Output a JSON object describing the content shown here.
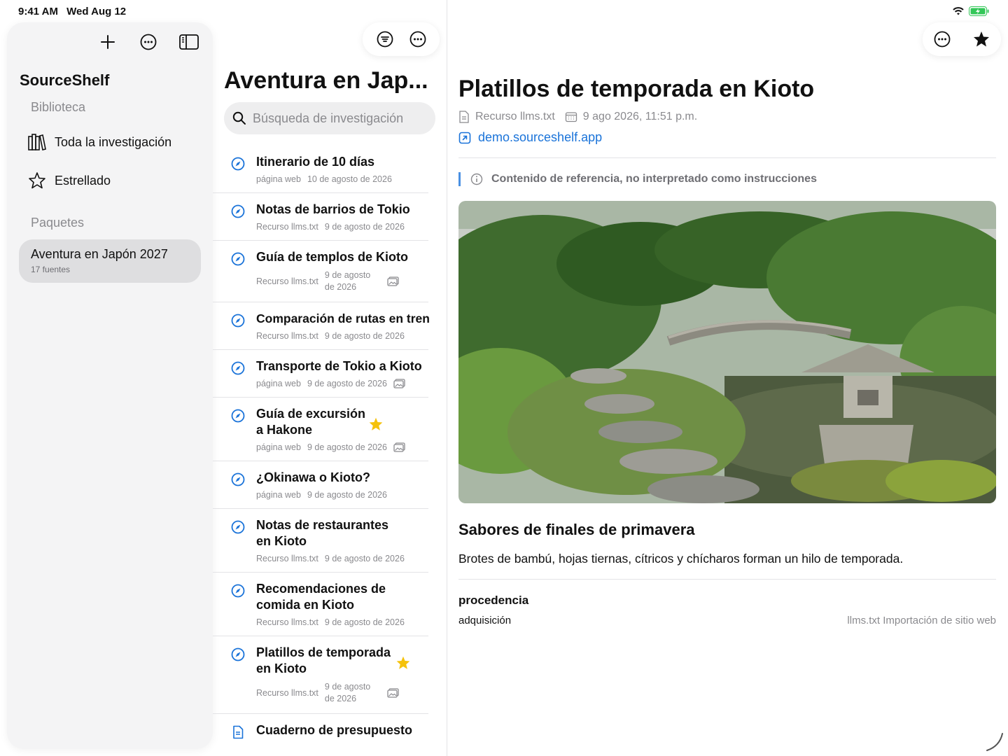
{
  "status_bar": {
    "time": "9:41 AM",
    "date": "Wed Aug 12"
  },
  "sidebar": {
    "app_title": "SourceShelf",
    "library_heading": "Biblioteca",
    "items": [
      {
        "label": "Toda la investigación",
        "icon": "books-icon"
      },
      {
        "label": "Estrellado",
        "icon": "star-outline-icon"
      }
    ],
    "packs_heading": "Paquetes",
    "pack": {
      "name": "Aventura en Japón 2027",
      "count": "17 fuentes"
    }
  },
  "list": {
    "title": "Aventura en Jap...",
    "search_placeholder": "Búsqueda de investigación",
    "rows": [
      {
        "title": "Itinerario de 10 días",
        "source": "página web",
        "date": "10 de agosto de 2026"
      },
      {
        "title": "Notas de barrios de Tokio",
        "source": "Recurso llms.txt",
        "date": "9 de agosto de 2026"
      },
      {
        "title": "Guía de templos de Kioto",
        "source": "Recurso llms.txt",
        "date": "9 de agosto de 2026"
      },
      {
        "title": "Comparación de rutas en tren",
        "source": "Recurso llms.txt",
        "date": "9 de agosto de 2026"
      },
      {
        "title": "Transporte de Tokio a Kioto",
        "source": "página web",
        "date": "9 de agosto de 2026"
      },
      {
        "title": "Guía de excursión a Hakone",
        "source": "página web",
        "date": "9 de agosto de 2026"
      },
      {
        "title": "¿Okinawa o Kioto?",
        "source": "página web",
        "date": "9 de agosto de 2026"
      },
      {
        "title": "Notas de restaurantes en Kioto",
        "source": "Recurso llms.txt",
        "date": "9 de agosto de 2026"
      },
      {
        "title": "Recomendaciones de comida en Kioto",
        "source": "Recurso llms.txt",
        "date": "9 de agosto de 2026"
      },
      {
        "title": "Platillos de temporada en Kioto",
        "source": "Recurso llms.txt",
        "date": "9 de agosto de 2026"
      },
      {
        "title": "Cuaderno de presupuesto"
      }
    ]
  },
  "detail": {
    "title": "Platillos de temporada en Kioto",
    "source": "Recurso llms.txt",
    "date": "9 ago 2026, 11:51 p.m.",
    "link": "demo.sourceshelf.app",
    "notice": "Contenido de referencia, no interpretado como instrucciones",
    "section_title": "Sabores de finales de primavera",
    "section_body": "Brotes de bambú, hojas tiernas, cítricos y chícharos forman un hilo de temporada.",
    "provenance_title": "procedencia",
    "provenance_key": "adquisición",
    "provenance_value": "llms.txt Importación de sitio web"
  },
  "colors": {
    "accent": "#1a73d9",
    "star": "#f5c20b",
    "sidebar_bg": "#f4f4f5"
  }
}
